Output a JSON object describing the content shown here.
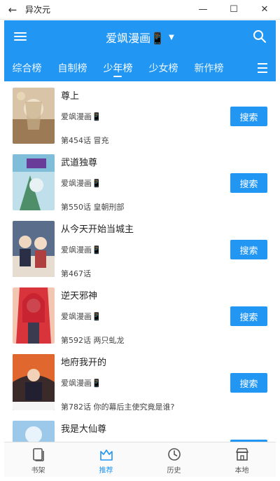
{
  "window": {
    "title": "异次元",
    "back_glyph": "←",
    "min_glyph": "—",
    "max_glyph": "☐",
    "close_glyph": "✕"
  },
  "header": {
    "title": "爱飒漫画📱",
    "caret": "▼",
    "accent": "#2196f3"
  },
  "tabs": [
    {
      "label": "综合榜",
      "active": false
    },
    {
      "label": "自制榜",
      "active": false
    },
    {
      "label": "少年榜",
      "active": true
    },
    {
      "label": "少女榜",
      "active": false
    },
    {
      "label": "新作榜",
      "active": false
    }
  ],
  "list": [
    {
      "title": "尊上",
      "source": "爱飒漫画📱",
      "chapter": "第454话 冒充",
      "button": "搜索"
    },
    {
      "title": "武道独尊",
      "source": "爱飒漫画📱",
      "chapter": "第550话 皇朝刑部",
      "button": "搜索"
    },
    {
      "title": "从今天开始当城主",
      "source": "爱飒漫画📱",
      "chapter": "第467话",
      "button": "搜索"
    },
    {
      "title": "逆天邪神",
      "source": "爱飒漫画📱",
      "chapter": "第592话 两只虬龙",
      "button": "搜索"
    },
    {
      "title": "地府我开的",
      "source": "爱飒漫画📱",
      "chapter": "第782话 你的幕后主使究竟是谁?",
      "button": "搜索"
    },
    {
      "title": "我是大仙尊",
      "source": "",
      "chapter": "",
      "button": ""
    }
  ],
  "bottom_nav": [
    {
      "label": "书架",
      "icon": "bookshelf-icon",
      "active": false
    },
    {
      "label": "推荐",
      "icon": "recommend-icon",
      "active": true
    },
    {
      "label": "历史",
      "icon": "history-icon",
      "active": false
    },
    {
      "label": "本地",
      "icon": "local-store-icon",
      "active": false
    }
  ]
}
